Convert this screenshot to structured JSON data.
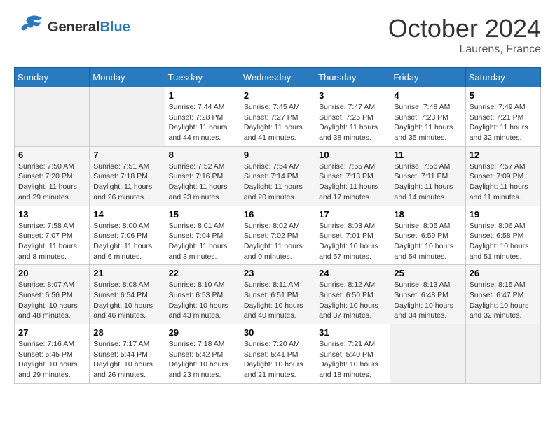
{
  "header": {
    "logo_general": "General",
    "logo_blue": "Blue",
    "month": "October 2024",
    "location": "Laurens, France"
  },
  "weekdays": [
    "Sunday",
    "Monday",
    "Tuesday",
    "Wednesday",
    "Thursday",
    "Friday",
    "Saturday"
  ],
  "weeks": [
    [
      {
        "day": "",
        "sunrise": "",
        "sunset": "",
        "daylight": ""
      },
      {
        "day": "",
        "sunrise": "",
        "sunset": "",
        "daylight": ""
      },
      {
        "day": "1",
        "sunrise": "Sunrise: 7:44 AM",
        "sunset": "Sunset: 7:28 PM",
        "daylight": "Daylight: 11 hours and 44 minutes."
      },
      {
        "day": "2",
        "sunrise": "Sunrise: 7:45 AM",
        "sunset": "Sunset: 7:27 PM",
        "daylight": "Daylight: 11 hours and 41 minutes."
      },
      {
        "day": "3",
        "sunrise": "Sunrise: 7:47 AM",
        "sunset": "Sunset: 7:25 PM",
        "daylight": "Daylight: 11 hours and 38 minutes."
      },
      {
        "day": "4",
        "sunrise": "Sunrise: 7:48 AM",
        "sunset": "Sunset: 7:23 PM",
        "daylight": "Daylight: 11 hours and 35 minutes."
      },
      {
        "day": "5",
        "sunrise": "Sunrise: 7:49 AM",
        "sunset": "Sunset: 7:21 PM",
        "daylight": "Daylight: 11 hours and 32 minutes."
      }
    ],
    [
      {
        "day": "6",
        "sunrise": "Sunrise: 7:50 AM",
        "sunset": "Sunset: 7:20 PM",
        "daylight": "Daylight: 11 hours and 29 minutes."
      },
      {
        "day": "7",
        "sunrise": "Sunrise: 7:51 AM",
        "sunset": "Sunset: 7:18 PM",
        "daylight": "Daylight: 11 hours and 26 minutes."
      },
      {
        "day": "8",
        "sunrise": "Sunrise: 7:52 AM",
        "sunset": "Sunset: 7:16 PM",
        "daylight": "Daylight: 11 hours and 23 minutes."
      },
      {
        "day": "9",
        "sunrise": "Sunrise: 7:54 AM",
        "sunset": "Sunset: 7:14 PM",
        "daylight": "Daylight: 11 hours and 20 minutes."
      },
      {
        "day": "10",
        "sunrise": "Sunrise: 7:55 AM",
        "sunset": "Sunset: 7:13 PM",
        "daylight": "Daylight: 11 hours and 17 minutes."
      },
      {
        "day": "11",
        "sunrise": "Sunrise: 7:56 AM",
        "sunset": "Sunset: 7:11 PM",
        "daylight": "Daylight: 11 hours and 14 minutes."
      },
      {
        "day": "12",
        "sunrise": "Sunrise: 7:57 AM",
        "sunset": "Sunset: 7:09 PM",
        "daylight": "Daylight: 11 hours and 11 minutes."
      }
    ],
    [
      {
        "day": "13",
        "sunrise": "Sunrise: 7:58 AM",
        "sunset": "Sunset: 7:07 PM",
        "daylight": "Daylight: 11 hours and 8 minutes."
      },
      {
        "day": "14",
        "sunrise": "Sunrise: 8:00 AM",
        "sunset": "Sunset: 7:06 PM",
        "daylight": "Daylight: 11 hours and 6 minutes."
      },
      {
        "day": "15",
        "sunrise": "Sunrise: 8:01 AM",
        "sunset": "Sunset: 7:04 PM",
        "daylight": "Daylight: 11 hours and 3 minutes."
      },
      {
        "day": "16",
        "sunrise": "Sunrise: 8:02 AM",
        "sunset": "Sunset: 7:02 PM",
        "daylight": "Daylight: 11 hours and 0 minutes."
      },
      {
        "day": "17",
        "sunrise": "Sunrise: 8:03 AM",
        "sunset": "Sunset: 7:01 PM",
        "daylight": "Daylight: 10 hours and 57 minutes."
      },
      {
        "day": "18",
        "sunrise": "Sunrise: 8:05 AM",
        "sunset": "Sunset: 6:59 PM",
        "daylight": "Daylight: 10 hours and 54 minutes."
      },
      {
        "day": "19",
        "sunrise": "Sunrise: 8:06 AM",
        "sunset": "Sunset: 6:58 PM",
        "daylight": "Daylight: 10 hours and 51 minutes."
      }
    ],
    [
      {
        "day": "20",
        "sunrise": "Sunrise: 8:07 AM",
        "sunset": "Sunset: 6:56 PM",
        "daylight": "Daylight: 10 hours and 48 minutes."
      },
      {
        "day": "21",
        "sunrise": "Sunrise: 8:08 AM",
        "sunset": "Sunset: 6:54 PM",
        "daylight": "Daylight: 10 hours and 46 minutes."
      },
      {
        "day": "22",
        "sunrise": "Sunrise: 8:10 AM",
        "sunset": "Sunset: 6:53 PM",
        "daylight": "Daylight: 10 hours and 43 minutes."
      },
      {
        "day": "23",
        "sunrise": "Sunrise: 8:11 AM",
        "sunset": "Sunset: 6:51 PM",
        "daylight": "Daylight: 10 hours and 40 minutes."
      },
      {
        "day": "24",
        "sunrise": "Sunrise: 8:12 AM",
        "sunset": "Sunset: 6:50 PM",
        "daylight": "Daylight: 10 hours and 37 minutes."
      },
      {
        "day": "25",
        "sunrise": "Sunrise: 8:13 AM",
        "sunset": "Sunset: 6:48 PM",
        "daylight": "Daylight: 10 hours and 34 minutes."
      },
      {
        "day": "26",
        "sunrise": "Sunrise: 8:15 AM",
        "sunset": "Sunset: 6:47 PM",
        "daylight": "Daylight: 10 hours and 32 minutes."
      }
    ],
    [
      {
        "day": "27",
        "sunrise": "Sunrise: 7:16 AM",
        "sunset": "Sunset: 5:45 PM",
        "daylight": "Daylight: 10 hours and 29 minutes."
      },
      {
        "day": "28",
        "sunrise": "Sunrise: 7:17 AM",
        "sunset": "Sunset: 5:44 PM",
        "daylight": "Daylight: 10 hours and 26 minutes."
      },
      {
        "day": "29",
        "sunrise": "Sunrise: 7:18 AM",
        "sunset": "Sunset: 5:42 PM",
        "daylight": "Daylight: 10 hours and 23 minutes."
      },
      {
        "day": "30",
        "sunrise": "Sunrise: 7:20 AM",
        "sunset": "Sunset: 5:41 PM",
        "daylight": "Daylight: 10 hours and 21 minutes."
      },
      {
        "day": "31",
        "sunrise": "Sunrise: 7:21 AM",
        "sunset": "Sunset: 5:40 PM",
        "daylight": "Daylight: 10 hours and 18 minutes."
      },
      {
        "day": "",
        "sunrise": "",
        "sunset": "",
        "daylight": ""
      },
      {
        "day": "",
        "sunrise": "",
        "sunset": "",
        "daylight": ""
      }
    ]
  ]
}
